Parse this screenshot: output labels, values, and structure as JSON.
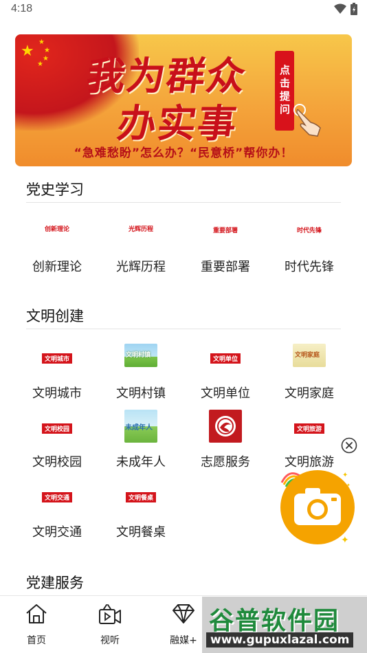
{
  "status_bar": {
    "time": "4:18"
  },
  "banner": {
    "title_line1": "我为群众",
    "title_line2": "办实事",
    "button_text": "点击提问",
    "slogan": "“急难愁盼”怎么办？“民意桥”帮你办！"
  },
  "sections": [
    {
      "title": "党史学习",
      "items": [
        {
          "label": "创新理论",
          "logo": "创新理论"
        },
        {
          "label": "光辉历程",
          "logo": "光辉历程"
        },
        {
          "label": "重要部署",
          "logo": "重要部署"
        },
        {
          "label": "时代先锋",
          "logo": "时代先锋"
        }
      ]
    },
    {
      "title": "文明创建",
      "items": [
        {
          "label": "文明城市",
          "logo": "文明城市"
        },
        {
          "label": "文明村镇",
          "logo": "文明村镇"
        },
        {
          "label": "文明单位",
          "logo": "文明单位"
        },
        {
          "label": "文明家庭",
          "logo": "文明家庭"
        },
        {
          "label": "文明校园",
          "logo": "文明校园"
        },
        {
          "label": "未成年人",
          "logo": "未成年人"
        },
        {
          "label": "志愿服务",
          "logo": ""
        },
        {
          "label": "文明旅游",
          "logo": "文明旅游"
        },
        {
          "label": "文明交通",
          "logo": "文明交通"
        },
        {
          "label": "文明餐桌",
          "logo": "文明餐桌"
        }
      ]
    },
    {
      "title": "党建服务"
    }
  ],
  "tabbar": [
    {
      "label": "首页",
      "icon": "home-icon"
    },
    {
      "label": "视听",
      "icon": "video-icon"
    },
    {
      "label": "融媒+",
      "icon": "diamond-icon"
    }
  ],
  "watermark": {
    "name": "谷普软件园",
    "url": "www.gupuxlazal.com"
  },
  "colors": {
    "accent_red": "#d4141b",
    "banner_orange": "#f4a43b",
    "fab_yellow": "#f5a300",
    "watermark_green": "#1f8a3c"
  }
}
